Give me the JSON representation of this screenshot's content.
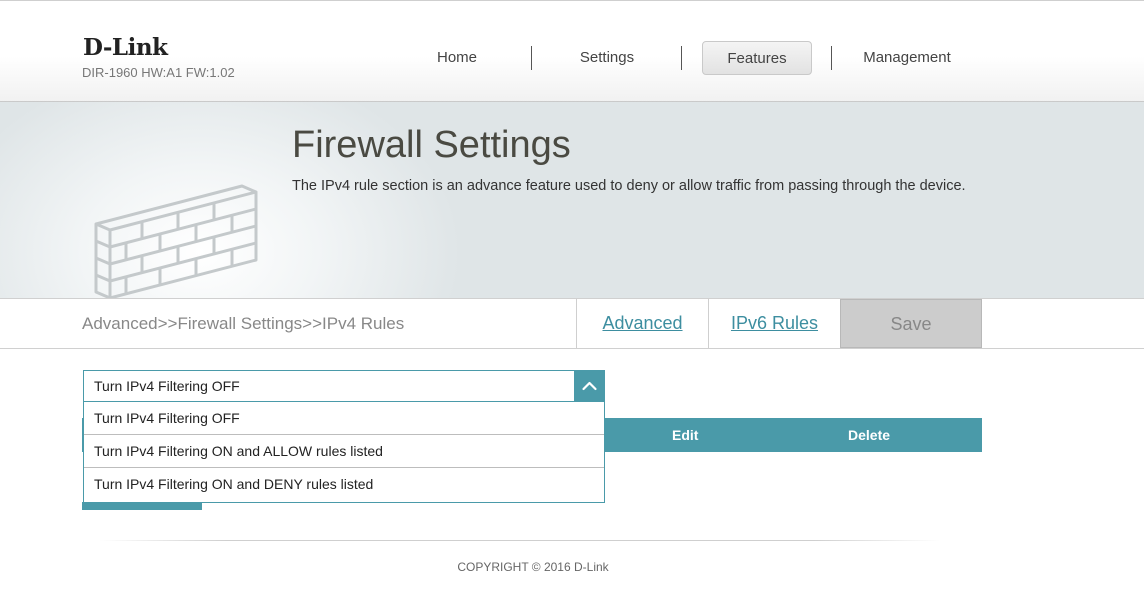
{
  "header": {
    "logo": "D-Link",
    "device_info": "DIR-1960 HW:A1 FW:1.02",
    "nav": [
      {
        "label": "Home"
      },
      {
        "label": "Settings"
      },
      {
        "label": "Features",
        "active": true
      },
      {
        "label": "Management"
      }
    ]
  },
  "banner": {
    "title": "Firewall Settings",
    "description": "The IPv4 rule section is an advance feature used to deny or allow traffic from passing through the device."
  },
  "breadcrumb": "Advanced>>Firewall Settings>>IPv4 Rules",
  "tabs": {
    "advanced": "Advanced",
    "ipv6": "IPv6 Rules",
    "save": "Save"
  },
  "filter_select": {
    "value": "Turn IPv4 Filtering OFF",
    "options": [
      "Turn IPv4 Filtering OFF",
      "Turn IPv4 Filtering ON and ALLOW rules listed",
      "Turn IPv4 Filtering ON and DENY rules listed"
    ]
  },
  "table": {
    "columns": [
      "Edit",
      "Delete"
    ]
  },
  "footer": {
    "copyright": "COPYRIGHT © 2016 D-Link"
  },
  "colors": {
    "accent": "#4a9aa9",
    "link": "#3d8ea0",
    "save_disabled_bg": "#cccccc"
  }
}
